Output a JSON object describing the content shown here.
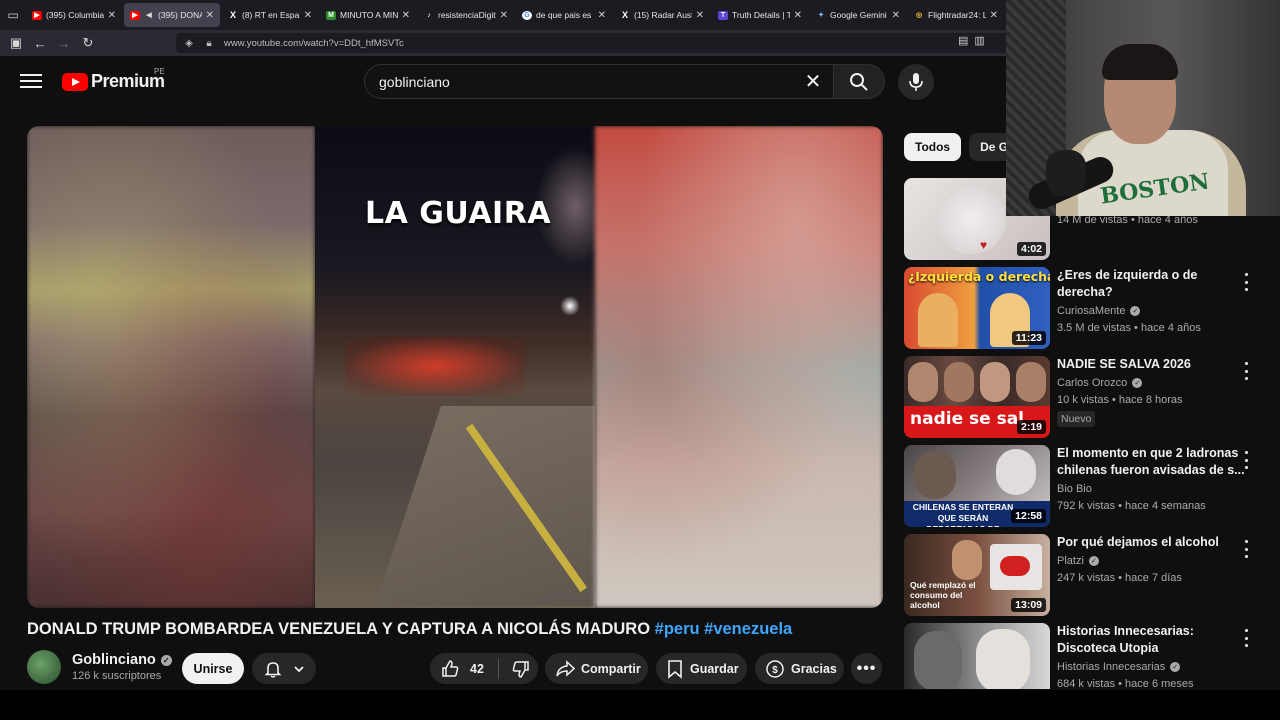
{
  "browser": {
    "tabs": [
      {
        "title": "(395) Columbia V",
        "fav": "yt"
      },
      {
        "title": "(395) DONA",
        "fav": "yt",
        "active": true
      },
      {
        "title": "(8) RT en Españo",
        "fav": "x"
      },
      {
        "title": "MINUTO A MIN",
        "fav": "m"
      },
      {
        "title": "resistenciaDigital",
        "fav": "tt"
      },
      {
        "title": "de que pais es +",
        "fav": "g"
      },
      {
        "title": "(15) Radar Austr",
        "fav": "x"
      },
      {
        "title": "Truth Details | Tr",
        "fav": "t"
      },
      {
        "title": "Google Gemini",
        "fav": "gem"
      },
      {
        "title": "Flightradar24: Li",
        "fav": "f"
      }
    ],
    "url": "www.youtube.com/watch?v=DDt_hfMSVTc"
  },
  "header": {
    "brand": "Premium",
    "country": "PE",
    "search_query": "goblinciano"
  },
  "video": {
    "overlay_caption": "LA GUAIRA",
    "title": "DONALD TRUMP BOMBARDEA VENEZUELA Y CAPTURA A NICOLÁS MADURO",
    "hashtags": "#peru #venezuela"
  },
  "channel": {
    "name": "Goblinciano",
    "subscribers": "126 k suscriptores",
    "join_label": "Unirse"
  },
  "actions": {
    "likes": "42",
    "share": "Compartir",
    "save": "Guardar",
    "thanks": "Gracias"
  },
  "sidebar": {
    "chips": [
      "Todos",
      "De Go"
    ],
    "items": [
      {
        "title": "",
        "channel": "",
        "meta": "14 M de vistas • hace 4 años",
        "duration": "4:02"
      },
      {
        "title": "¿Eres de izquierda o de derecha?",
        "channel": "CuriosaMente",
        "meta": "3.5 M de vistas • hace 4 años",
        "duration": "11:23",
        "thumb_text": "¿Izquierda o derecha?"
      },
      {
        "title": "NADIE SE SALVA 2026",
        "channel": "Carlos Orozco",
        "meta": "10 k vistas • hace 8 horas",
        "duration": "2:19",
        "badge": "Nuevo",
        "thumb_text": "nadie se sal"
      },
      {
        "title": "El momento en que 2 ladronas chilenas fueron avisadas de s...",
        "channel": "Bio Bio",
        "meta": "792 k vistas • hace 4 semanas",
        "duration": "12:58",
        "thumb_text": "CHILENAS SE ENTERAN QUE SERÁN DEPORTADAS DE"
      },
      {
        "title": "Por qué dejamos el alcohol",
        "channel": "Platzi",
        "meta": "247 k vistas • hace 7 días",
        "duration": "13:09",
        "thumb_text": "Qué remplazó el consumo del alcohol"
      },
      {
        "title": "Historias Innecesarias: Discoteca Utopia",
        "channel": "Historias Innecesarias",
        "meta": "684 k vistas • hace 6 meses",
        "duration": ""
      }
    ]
  },
  "webcam": {
    "shirt_text": "BOSTON"
  },
  "colors": {
    "accent": "#3ea6ff",
    "brand_red": "#ff0000",
    "background": "#0f0f0f"
  }
}
